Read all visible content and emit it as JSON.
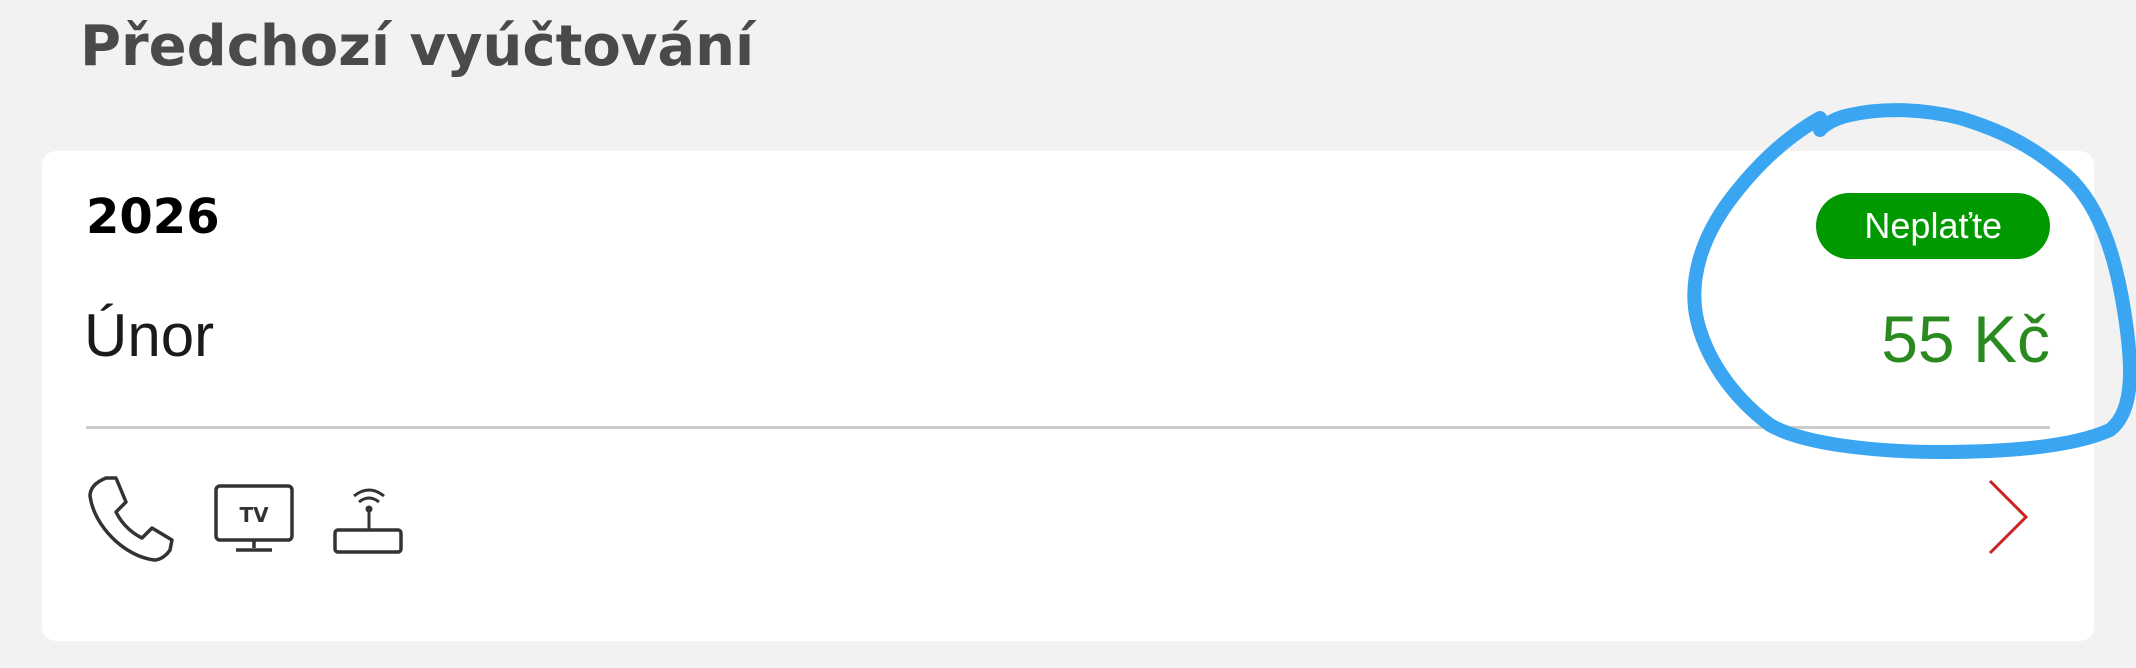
{
  "section": {
    "title": "Předchozí vyúčtování"
  },
  "bill": {
    "year": "2026",
    "month": "Únor",
    "status_badge": "Neplaťte",
    "amount": "55 Kč"
  },
  "services": [
    {
      "icon": "phone-icon"
    },
    {
      "icon": "tv-icon",
      "label": "TV"
    },
    {
      "icon": "router-icon"
    }
  ],
  "colors": {
    "background": "#f2f2f2",
    "card": "#ffffff",
    "badge": "#009900",
    "amount": "#2a8a1f",
    "chevron": "#cc2222",
    "annotation": "#3aa5f0"
  }
}
